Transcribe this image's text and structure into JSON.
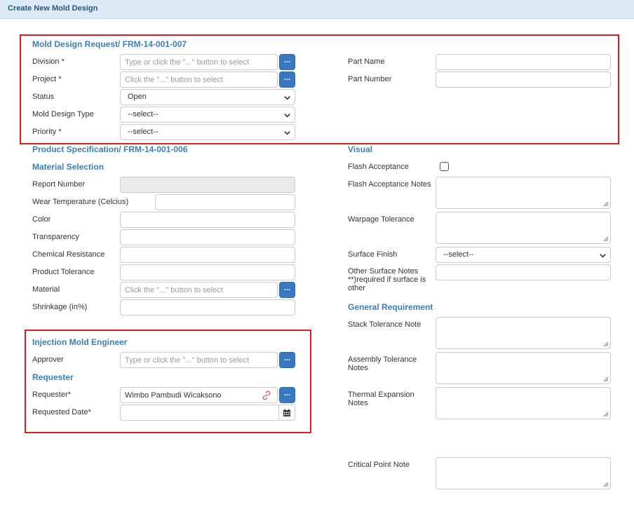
{
  "header": {
    "title": "Create New Mold Design"
  },
  "mold_request": {
    "section_title": "Mold Design Request/ FRM-14-001-007",
    "division": {
      "label": "Division *",
      "placeholder": "Type or click the \"...\" button to select",
      "button": "..."
    },
    "project": {
      "label": "Project *",
      "placeholder": "Click the \"...\" button to select",
      "button": "..."
    },
    "status": {
      "label": "Status",
      "value": "Open"
    },
    "mold_design_type": {
      "label": "Mold Design Type",
      "value": "--select--"
    },
    "priority": {
      "label": "Priority *",
      "value": "--select--"
    },
    "part_name": {
      "label": "Part Name",
      "value": ""
    },
    "part_number": {
      "label": "Part Number",
      "value": ""
    }
  },
  "product_spec": {
    "section_title": "Product Specification/ FRM-14-001-006",
    "material_selection_title": "Material Selection",
    "report_number": {
      "label": "Report Number"
    },
    "wear_temperature": {
      "label": "Wear Temperature (Celcius)"
    },
    "color": {
      "label": "Color"
    },
    "transparency": {
      "label": "Transparency"
    },
    "chemical_resistance": {
      "label": "Chemical Resistance"
    },
    "product_tolerance": {
      "label": "Product Tolerance"
    },
    "material": {
      "label": "Material",
      "placeholder": "Click the \"...\" button to select",
      "button": "..."
    },
    "shrinkage": {
      "label": "Shrinkage (in%)"
    }
  },
  "visual": {
    "section_title": "Visual",
    "flash_acceptance": {
      "label": "Flash Acceptance"
    },
    "flash_acceptance_notes": {
      "label": "Flash Acceptance Notes"
    },
    "warpage_tolerance": {
      "label": "Warpage Tolerance"
    },
    "surface_finish": {
      "label": "Surface Finish",
      "value": "--select--"
    },
    "other_surface_notes": {
      "label": "Other Surface Notes **)required if surface is other"
    }
  },
  "general_requirement": {
    "section_title": "General Requirement",
    "stack_tolerance_note": {
      "label": "Stack Tolerance Note"
    },
    "assembly_tolerance_notes": {
      "label": "Assembly Tolerance Notes"
    },
    "thermal_expansion_notes": {
      "label": "Thermal Expansion Notes"
    },
    "critical_point_note": {
      "label": "Critical Point Note"
    }
  },
  "engineer": {
    "section_title": "Injection Mold Engineer",
    "approver": {
      "label": "Approver",
      "placeholder": "Type or click the \"...\" button to select",
      "button": "..."
    },
    "requester_title": "Requester",
    "requester": {
      "label": "Requester*",
      "value": "Wimbo Pambudi Wicaksono",
      "button": "..."
    },
    "requested_date": {
      "label": "Requested Date*",
      "value": ""
    }
  },
  "colors": {
    "accent": "#3a7fb7",
    "button": "#3a78c2",
    "highlight": "#e01b1b",
    "header_bg": "#dcebf5"
  },
  "icons": [
    "chevron-down-icon",
    "calendar-icon",
    "unlink-icon",
    "resize-grip-icon"
  ]
}
